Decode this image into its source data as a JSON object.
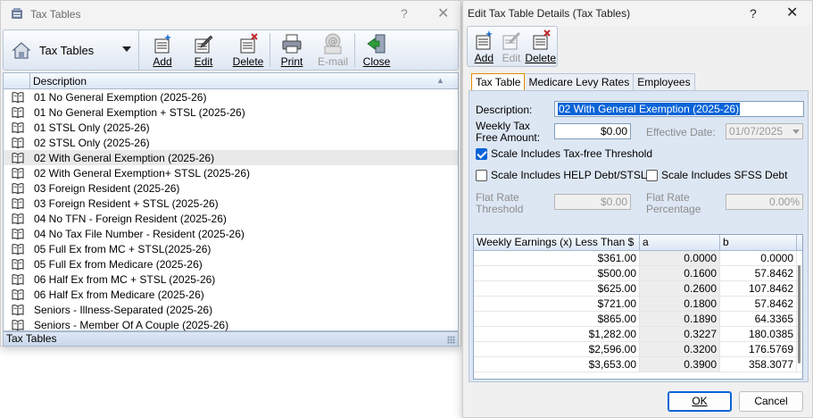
{
  "left_window": {
    "title": "Tax Tables",
    "help_glyph": "?",
    "close_glyph": "✕",
    "toolbar": {
      "combo_label": "Tax Tables",
      "add": "Add",
      "edit": "Edit",
      "delete": "Delete",
      "print": "Print",
      "email": "E-mail",
      "close": "Close"
    },
    "list": {
      "column": "Description",
      "items": [
        "01 No General Exemption (2025-26)",
        "01 No General Exemption + STSL (2025-26)",
        "01 STSL Only (2025-26)",
        "02 STSL Only (2025-26)",
        "02 With General Exemption (2025-26)",
        "02 With General Exemption+ STSL (2025-26)",
        "03 Foreign Resident (2025-26)",
        "03 Foreign Resident + STSL (2025-26)",
        "04 No TFN - Foreign Resident (2025-26)",
        "04 No Tax File Number - Resident (2025-26)",
        "05 Full Ex from MC + STSL(2025-26)",
        "05 Full Ex from Medicare (2025-26)",
        "06 Half Ex from MC + STSL (2025-26)",
        "06 Half Ex from Medicare (2025-26)",
        "Seniors - Illness-Separated (2025-26)",
        "Seniors - Member Of A Couple (2025-26)"
      ],
      "selected_index": 4
    },
    "status": "Tax Tables"
  },
  "right_window": {
    "title": "Edit Tax Table Details (Tax Tables)",
    "help_glyph": "?",
    "close_glyph": "✕",
    "toolbar": {
      "add": "Add",
      "edit": "Edit",
      "delete": "Delete"
    },
    "tabs": [
      "Tax Table",
      "Medicare Levy Rates",
      "Employees"
    ],
    "form": {
      "description_label": "Description:",
      "description_value": "02 With General Exemption (2025-26)",
      "weekly_label_1": "Weekly Tax",
      "weekly_label_2": "Free Amount:",
      "weekly_value": "$0.00",
      "effective_label": "Effective Date:",
      "effective_value": "01/07/2025",
      "chk_taxfree": "Scale Includes Tax-free Threshold",
      "chk_taxfree_checked": true,
      "chk_help": "Scale Includes HELP Debt/STSL",
      "chk_help_checked": false,
      "chk_sfss": "Scale Includes SFSS Debt",
      "chk_sfss_checked": false,
      "flat_threshold_1": "Flat Rate",
      "flat_threshold_2": "Threshold",
      "flat_threshold_value": "$0.00",
      "flat_pct_1": "Flat Rate",
      "flat_pct_2": "Percentage",
      "flat_pct_value": "0.00%"
    },
    "grid": {
      "headers": [
        "Weekly Earnings (x) Less Than $",
        "a",
        "b"
      ],
      "rows": [
        [
          "$361.00",
          "0.0000",
          "0.0000"
        ],
        [
          "$500.00",
          "0.1600",
          "57.8462"
        ],
        [
          "$625.00",
          "0.2600",
          "107.8462"
        ],
        [
          "$721.00",
          "0.1800",
          "57.8462"
        ],
        [
          "$865.00",
          "0.1890",
          "64.3365"
        ],
        [
          "$1,282.00",
          "0.3227",
          "180.0385"
        ],
        [
          "$2,596.00",
          "0.3200",
          "176.5769"
        ],
        [
          "$3,653.00",
          "0.3900",
          "358.3077"
        ]
      ]
    },
    "ok": "OK",
    "cancel": "Cancel"
  },
  "colors": {
    "accent": "#0a64d8",
    "tab_active_border": "#e08a00",
    "panel": "#dde7f4"
  }
}
